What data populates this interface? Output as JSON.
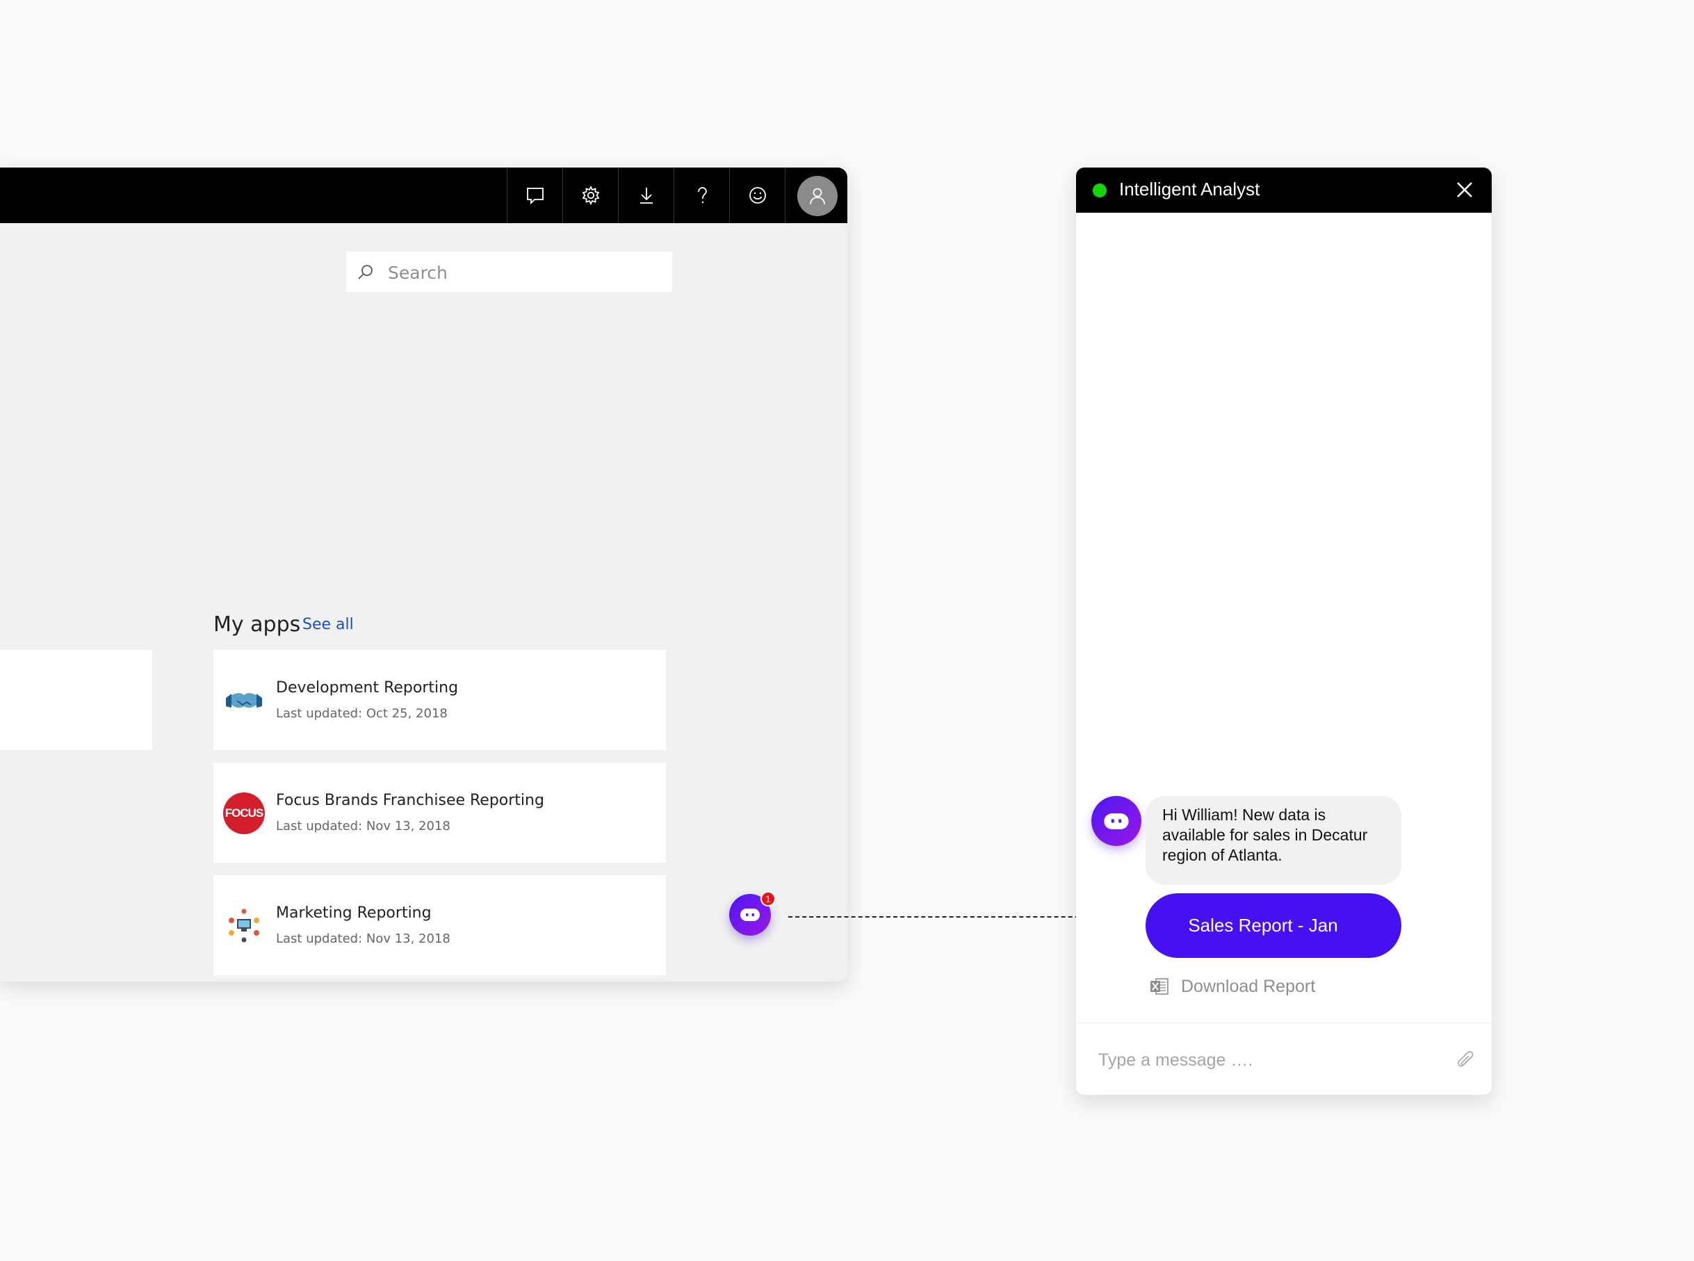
{
  "app": {
    "topbar": {
      "icons": [
        "chat-icon",
        "gear-icon",
        "download-icon",
        "help-icon",
        "smiley-icon",
        "user-icon"
      ]
    },
    "search": {
      "placeholder": "Search",
      "value": ""
    },
    "my_apps": {
      "title": "My apps",
      "see_all": "See all",
      "items": [
        {
          "name": "Development Reporting",
          "updated": "Last updated: Oct 25, 2018",
          "icon": "handshake-icon"
        },
        {
          "name": "Focus Brands Franchisee Reporting",
          "updated": "Last updated: Nov 13, 2018",
          "icon": "focus-logo",
          "logo_text": "FOCUS",
          "logo_color": "#d21f2b"
        },
        {
          "name": "Marketing Reporting",
          "updated": "Last updated: Nov 13, 2018",
          "icon": "marketing-icon"
        }
      ]
    },
    "bot_fab": {
      "badge": "1",
      "icon": "bot-icon"
    }
  },
  "chat": {
    "title": "Intelligent Analyst",
    "status_color": "#17d40a",
    "accent": "#4610f0",
    "message": "Hi William! New data is available for sales in Decatur region of Atlanta.",
    "action_button": "Sales Report - Jan",
    "download_label": "Download Report",
    "download_icon": "excel-icon",
    "composer": {
      "placeholder": "Type a message ….",
      "value": ""
    },
    "attach_icon": "paperclip-icon"
  }
}
